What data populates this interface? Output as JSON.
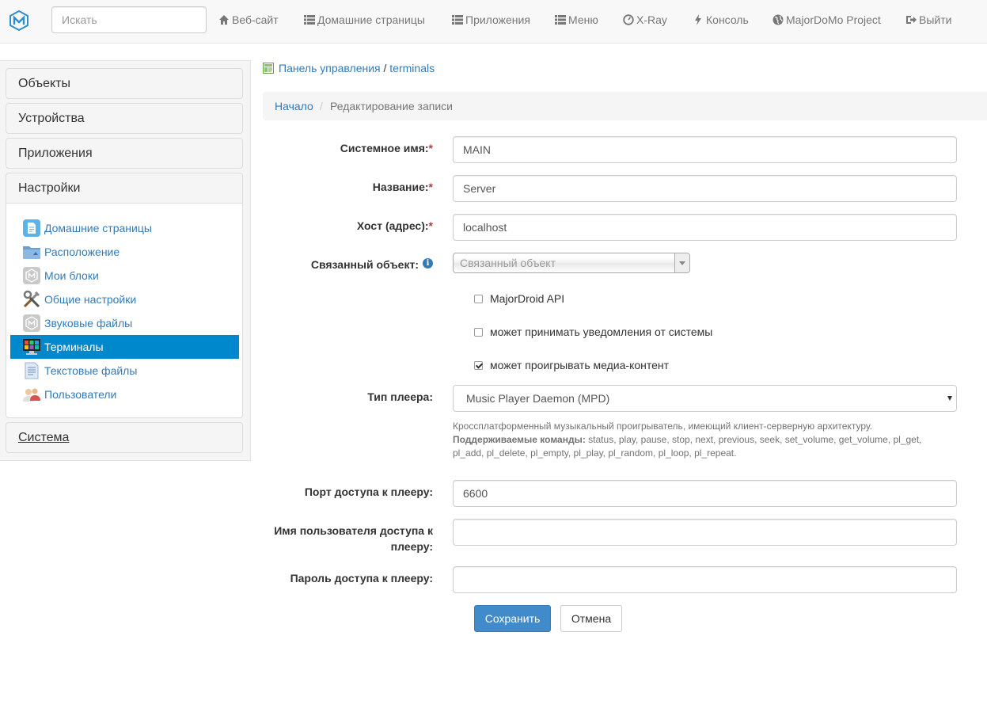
{
  "navbar": {
    "search_placeholder": "Искать",
    "items": [
      {
        "label": "Веб-сайт",
        "icon": "home-icon"
      },
      {
        "label": "Домашние страницы",
        "icon": "list-icon"
      },
      {
        "label": "Приложения",
        "icon": "list-icon"
      },
      {
        "label": "Меню",
        "icon": "list-icon"
      },
      {
        "label": "X-Ray",
        "icon": "dashboard-icon"
      },
      {
        "label": "Консоль",
        "icon": "flash-icon"
      },
      {
        "label": "MajorDoMo Project",
        "icon": "globe-icon"
      },
      {
        "label": "Выйти",
        "icon": "logout-icon"
      }
    ]
  },
  "sidebar": {
    "panels": [
      "Объекты",
      "Устройства",
      "Приложения",
      "Настройки",
      "Система"
    ],
    "items": [
      {
        "label": "Домашние страницы",
        "icon": "document-icon"
      },
      {
        "label": "Расположение",
        "icon": "folder-icon"
      },
      {
        "label": "Мои блоки",
        "icon": "majordomo-icon"
      },
      {
        "label": "Общие настройки",
        "icon": "tools-icon"
      },
      {
        "label": "Звуковые файлы",
        "icon": "majordomo-icon"
      },
      {
        "label": "Терминалы",
        "icon": "monitor-icon",
        "active": true
      },
      {
        "label": "Текстовые файлы",
        "icon": "text-file-icon"
      },
      {
        "label": "Пользователи",
        "icon": "users-icon"
      }
    ]
  },
  "header": {
    "crumb_root": "Панель управления",
    "crumb_sep": "/",
    "crumb_current": "terminals"
  },
  "breadcrumb": {
    "home": "Начало",
    "sep": "/",
    "current": "Редактирование записи"
  },
  "form": {
    "system_name": {
      "label": "Системное имя:",
      "required": "*",
      "value": "MAIN"
    },
    "title": {
      "label": "Название:",
      "required": "*",
      "value": "Server"
    },
    "host": {
      "label": "Хост (адрес):",
      "required": "*",
      "value": "localhost"
    },
    "linked_object": {
      "label": "Связанный объект:",
      "placeholder": "Связанный объект",
      "info": "i"
    },
    "checkboxes": [
      {
        "label": "MajorDroid API",
        "checked": false
      },
      {
        "label": "может принимать уведомления от системы",
        "checked": false
      },
      {
        "label": "может проигрывать медиа-контент",
        "checked": true
      }
    ],
    "player_type": {
      "label": "Тип плеера:",
      "value": "Music Player Daemon (MPD)"
    },
    "help": {
      "description": "Кроссплатформенный музыкальный проигрыватель, имеющий клиент-серверную архитектуру.",
      "commands_label": "Поддерживаемые команды:",
      "commands": "status, play, pause, stop, next, previous, seek, set_volume, get_volume, pl_get, pl_add, pl_delete, pl_empty, pl_play, pl_random, pl_loop, pl_repeat."
    },
    "player_port": {
      "label": "Порт доступа к плееру:",
      "value": "6600"
    },
    "player_user": {
      "label_line1": "Имя пользователя доступа к",
      "label_line2": "плееру:",
      "value": ""
    },
    "player_password": {
      "label": "Пароль доступа к плееру:",
      "value": ""
    },
    "save_label": "Сохранить",
    "cancel_label": "Отмена"
  },
  "colors": {
    "accent": "#337ab7",
    "active_item": "#0088cc",
    "primary_button": "#428bca",
    "required": "#a94442"
  }
}
